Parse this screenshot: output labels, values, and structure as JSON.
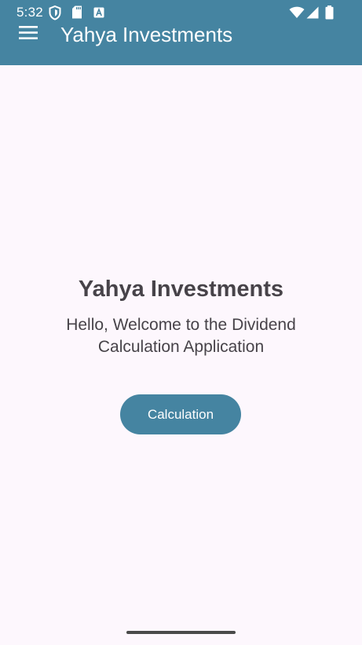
{
  "status_bar": {
    "time": "5:32",
    "left_icons": [
      "shield-icon",
      "sd-card-icon",
      "a-notification-icon"
    ],
    "right_icons": [
      "wifi-icon",
      "signal-icon",
      "battery-icon"
    ]
  },
  "app_bar": {
    "menu_icon": "hamburger-menu-icon",
    "title": "Yahya Investments",
    "color": "#4584a1"
  },
  "main": {
    "title": "Yahya Investments",
    "welcome": "Hello, Welcome to the Dividend Calculation Application",
    "button_label": "Calculation"
  },
  "colors": {
    "primary": "#4584a1",
    "background": "#fdf7fd",
    "text": "#474349"
  }
}
